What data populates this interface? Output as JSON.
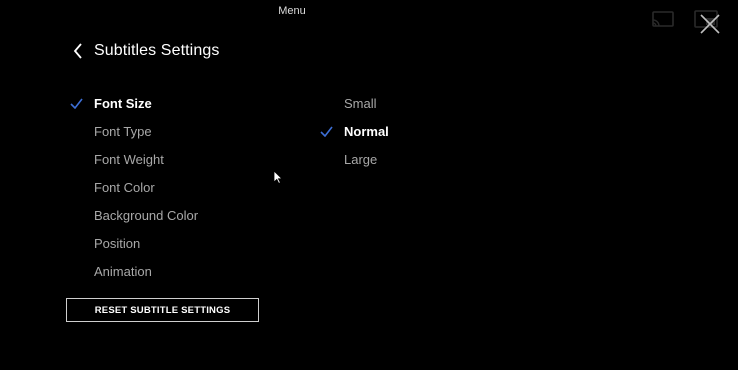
{
  "window": {
    "menu_title": "Menu"
  },
  "header": {
    "title": "Subtitles Settings"
  },
  "settings": {
    "options": [
      {
        "label": "Font Size",
        "selected": true
      },
      {
        "label": "Font Type",
        "selected": false
      },
      {
        "label": "Font Weight",
        "selected": false
      },
      {
        "label": "Font Color",
        "selected": false
      },
      {
        "label": "Background Color",
        "selected": false
      },
      {
        "label": "Position",
        "selected": false
      },
      {
        "label": "Animation",
        "selected": false
      }
    ],
    "font_size_values": [
      {
        "label": "Small",
        "selected": false
      },
      {
        "label": "Normal",
        "selected": true
      },
      {
        "label": "Large",
        "selected": false
      }
    ]
  },
  "reset_button": {
    "label": "RESET SUBTITLE SETTINGS"
  },
  "icons": {
    "back": "chevron-left-icon",
    "check": "check-icon",
    "close": "close-icon",
    "cast": "cast-icon",
    "pip": "picture-in-picture-icon",
    "cursor": "mouse-cursor-icon"
  },
  "colors": {
    "background": "#000000",
    "accent_check": "#3d6fd6",
    "selected_text": "#ffffff",
    "unselected_text": "#a8a8a8"
  }
}
